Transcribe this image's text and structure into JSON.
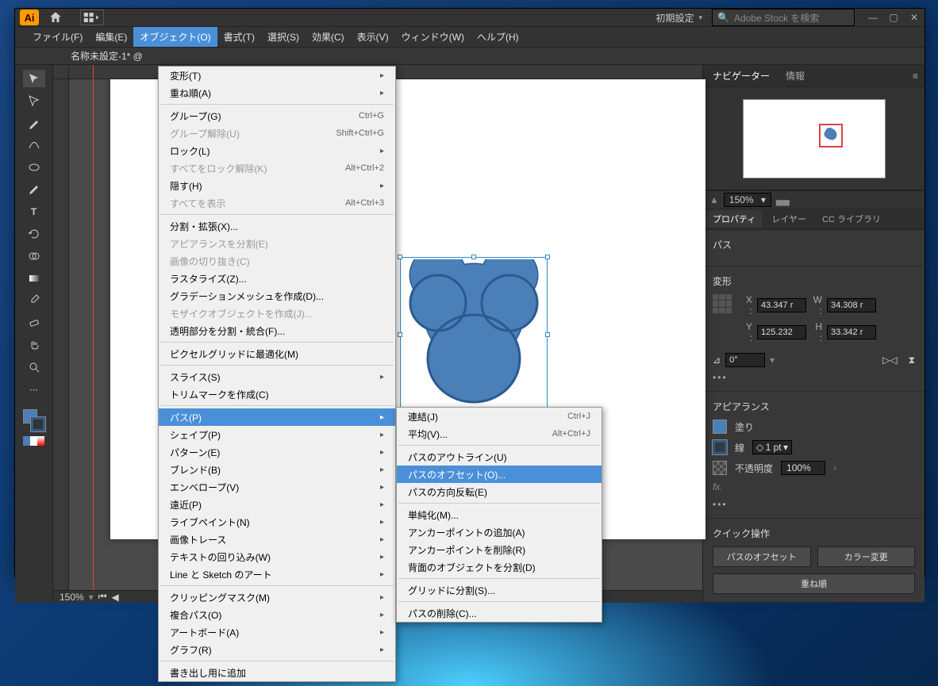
{
  "titlebar": {
    "preset": "初期設定",
    "search_placeholder": "Adobe Stock を検索"
  },
  "menubar": [
    "ファイル(F)",
    "編集(E)",
    "オブジェクト(O)",
    "書式(T)",
    "選択(S)",
    "効果(C)",
    "表示(V)",
    "ウィンドウ(W)",
    "ヘルプ(H)"
  ],
  "menubar_active": 2,
  "doc_tab": "名称未設定-1* @",
  "status_zoom": "150%",
  "object_menu": [
    {
      "label": "変形(T)",
      "sub": true
    },
    {
      "label": "重ね順(A)",
      "sub": true
    },
    {
      "sep": true
    },
    {
      "label": "グループ(G)",
      "shortcut": "Ctrl+G"
    },
    {
      "label": "グループ解除(U)",
      "shortcut": "Shift+Ctrl+G",
      "disabled": true
    },
    {
      "label": "ロック(L)",
      "sub": true
    },
    {
      "label": "すべてをロック解除(K)",
      "shortcut": "Alt+Ctrl+2",
      "disabled": true
    },
    {
      "label": "隠す(H)",
      "sub": true
    },
    {
      "label": "すべてを表示",
      "shortcut": "Alt+Ctrl+3",
      "disabled": true
    },
    {
      "sep": true
    },
    {
      "label": "分割・拡張(X)..."
    },
    {
      "label": "アピアランスを分割(E)",
      "disabled": true
    },
    {
      "label": "画像の切り抜き(C)",
      "disabled": true
    },
    {
      "label": "ラスタライズ(Z)..."
    },
    {
      "label": "グラデーションメッシュを作成(D)..."
    },
    {
      "label": "モザイクオブジェクトを作成(J)...",
      "disabled": true
    },
    {
      "label": "透明部分を分割・統合(F)..."
    },
    {
      "sep": true
    },
    {
      "label": "ピクセルグリッドに最適化(M)"
    },
    {
      "sep": true
    },
    {
      "label": "スライス(S)",
      "sub": true
    },
    {
      "label": "トリムマークを作成(C)"
    },
    {
      "sep": true
    },
    {
      "label": "パス(P)",
      "sub": true,
      "hl": true
    },
    {
      "label": "シェイプ(P)",
      "sub": true
    },
    {
      "label": "パターン(E)",
      "sub": true
    },
    {
      "label": "ブレンド(B)",
      "sub": true
    },
    {
      "label": "エンベロープ(V)",
      "sub": true
    },
    {
      "label": "遠近(P)",
      "sub": true
    },
    {
      "label": "ライブペイント(N)",
      "sub": true
    },
    {
      "label": "画像トレース",
      "sub": true
    },
    {
      "label": "テキストの回り込み(W)",
      "sub": true
    },
    {
      "label": "Line と Sketch のアート",
      "sub": true
    },
    {
      "sep": true
    },
    {
      "label": "クリッピングマスク(M)",
      "sub": true
    },
    {
      "label": "複合パス(O)",
      "sub": true
    },
    {
      "label": "アートボード(A)",
      "sub": true
    },
    {
      "label": "グラフ(R)",
      "sub": true
    },
    {
      "sep": true
    },
    {
      "label": "書き出し用に追加"
    }
  ],
  "path_menu": [
    {
      "label": "連結(J)",
      "shortcut": "Ctrl+J"
    },
    {
      "label": "平均(V)...",
      "shortcut": "Alt+Ctrl+J"
    },
    {
      "sep": true
    },
    {
      "label": "パスのアウトライン(U)"
    },
    {
      "label": "パスのオフセット(O)...",
      "hl": true
    },
    {
      "label": "パスの方向反転(E)"
    },
    {
      "sep": true
    },
    {
      "label": "単純化(M)..."
    },
    {
      "label": "アンカーポイントの追加(A)"
    },
    {
      "label": "アンカーポイントを削除(R)"
    },
    {
      "label": "背面のオブジェクトを分割(D)"
    },
    {
      "sep": true
    },
    {
      "label": "グリッドに分割(S)..."
    },
    {
      "sep": true
    },
    {
      "label": "パスの削除(C)..."
    }
  ],
  "panels": {
    "nav_tab": "ナビゲーター",
    "info_tab": "情報",
    "nav_zoom": "150%",
    "prop_tabs": [
      "プロパティ",
      "レイヤー",
      "CC ライブラリ"
    ],
    "prop_active": 0,
    "obj_type": "パス",
    "transform_title": "変形",
    "x": "43.347 r",
    "y": "125.232",
    "w": "34.308 r",
    "h": "33.342 r",
    "angle": "0°",
    "appearance_title": "アピアランス",
    "fill_label": "塗り",
    "stroke_label": "線",
    "stroke_w": "1 pt",
    "opacity_label": "不透明度",
    "opacity": "100%",
    "fx": "fx.",
    "quick_title": "クイック操作",
    "btn_offset": "パスのオフセット",
    "btn_recolor": "カラー変更",
    "btn_arrange": "重ね順"
  }
}
